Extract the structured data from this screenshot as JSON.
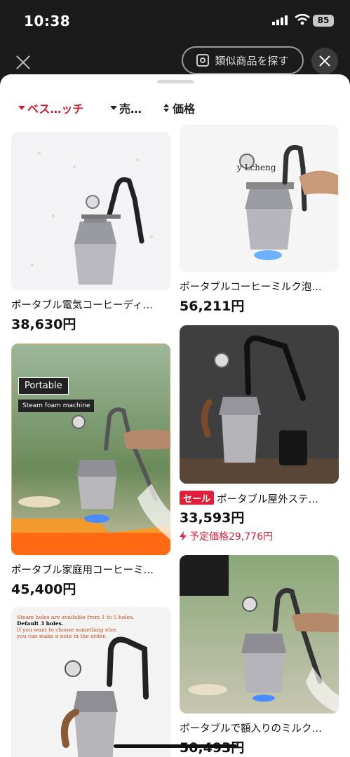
{
  "status_bar": {
    "time": "10:38",
    "battery": "85"
  },
  "top_bar": {
    "similar_label": "類似商品を探す"
  },
  "sort_tabs": [
    {
      "label": "ベス…ッチ"
    },
    {
      "label": "売…"
    },
    {
      "label": "価格"
    }
  ],
  "products": [
    {
      "name": "ポータブル電気コーヒーディ…",
      "price": "38,630円"
    },
    {
      "name": "ポータブルコーヒーミルク泡…",
      "price": "56,211円",
      "watermark": "y Lcheng"
    },
    {
      "name": "ポータブル家庭用コーヒーミ…",
      "price": "45,400円",
      "overlay_title": "Portable",
      "overlay_sub": "Steam foam machine"
    },
    {
      "badge": "セール",
      "name": "ポータブル屋外ステ…",
      "price": "33,593円",
      "planned_label": "予定価格",
      "planned_price": "29,776円"
    },
    {
      "name": "",
      "price": "",
      "caption_lines": [
        "Steam holes are available from 1 to 5 holes.",
        "Default 3 holes.",
        "If you want to choose something else,",
        "you can make a note in the order."
      ]
    },
    {
      "name": "ポータブルで額入りのミルク…",
      "price": "50,493円"
    }
  ],
  "colors": {
    "accent": "#d0202e",
    "sale": "#e0203a"
  }
}
